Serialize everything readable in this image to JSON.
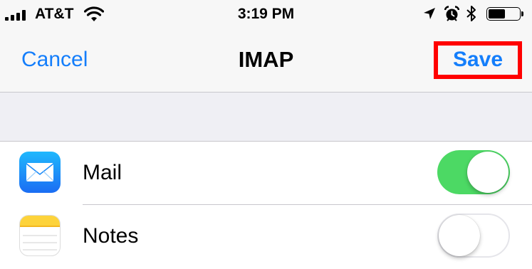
{
  "status_bar": {
    "carrier": "AT&T",
    "time": "3:19 PM",
    "battery_level": 0.55
  },
  "nav": {
    "cancel_label": "Cancel",
    "title": "IMAP",
    "save_label": "Save"
  },
  "list": {
    "items": [
      {
        "label": "Mail",
        "icon": "mail-icon",
        "enabled": true
      },
      {
        "label": "Notes",
        "icon": "notes-icon",
        "enabled": false
      }
    ]
  },
  "colors": {
    "accent": "#147efb",
    "toggle_on": "#4cd964",
    "highlight": "#ff0000"
  }
}
